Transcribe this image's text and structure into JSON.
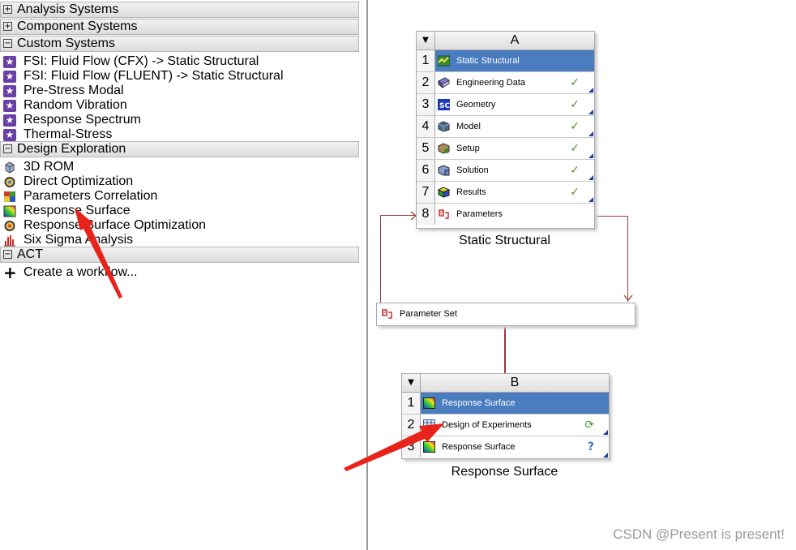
{
  "toolbox": {
    "categories": [
      {
        "label": "Analysis Systems",
        "toggle": "⊞"
      },
      {
        "label": "Component Systems",
        "toggle": "⊞"
      },
      {
        "label": "Custom Systems",
        "toggle": "⊟"
      },
      {
        "label": "Design Exploration",
        "toggle": "⊟"
      },
      {
        "label": "ACT",
        "toggle": "⊟"
      }
    ],
    "custom_items": [
      "FSI: Fluid Flow (CFX) -> Static Structural",
      "FSI: Fluid Flow (FLUENT) -> Static Structural",
      "Pre-Stress Modal",
      "Random Vibration",
      "Response Spectrum",
      "Thermal-Stress"
    ],
    "design_items": [
      "3D ROM",
      "Direct Optimization",
      "Parameters Correlation",
      "Response Surface",
      "Response Surface Optimization",
      "Six Sigma Analysis"
    ],
    "act_items": [
      "Create a workflow..."
    ]
  },
  "system_a": {
    "column": "A",
    "rows": [
      {
        "num": "1",
        "label": "Static Structural",
        "status": ""
      },
      {
        "num": "2",
        "label": "Engineering Data",
        "status": "✓"
      },
      {
        "num": "3",
        "label": "Geometry",
        "status": "✓"
      },
      {
        "num": "4",
        "label": "Model",
        "status": "✓"
      },
      {
        "num": "5",
        "label": "Setup",
        "status": "✓"
      },
      {
        "num": "6",
        "label": "Solution",
        "status": "✓"
      },
      {
        "num": "7",
        "label": "Results",
        "status": "✓"
      },
      {
        "num": "8",
        "label": "Parameters",
        "status": ""
      }
    ],
    "label": "Static Structural"
  },
  "parameter_set": {
    "label": "Parameter Set"
  },
  "system_b": {
    "column": "B",
    "rows": [
      {
        "num": "1",
        "label": "Response Surface",
        "status": ""
      },
      {
        "num": "2",
        "label": "Design of Experiments",
        "status": "⟳"
      },
      {
        "num": "3",
        "label": "Response Surface",
        "status": "?"
      }
    ],
    "label": "Response Surface"
  },
  "watermark": "CSDN @Present is present!",
  "colors": {
    "selected_row": "#4a7cc0",
    "connector": "#9b3a3a",
    "arrow": "#e8231b",
    "check": "#5a8a2a"
  }
}
